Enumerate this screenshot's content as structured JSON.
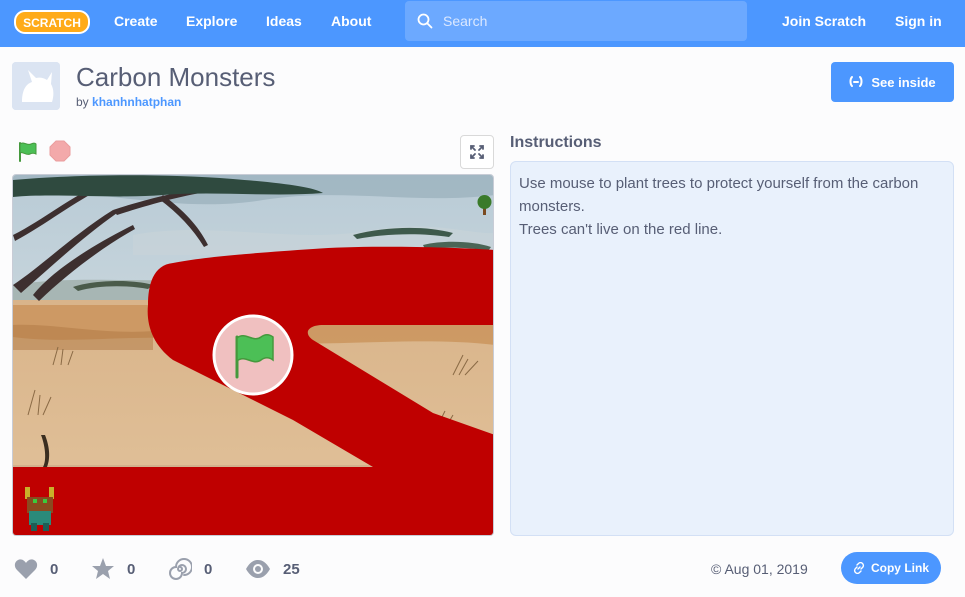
{
  "nav": {
    "logo_text": "SCRATCH",
    "create": "Create",
    "explore": "Explore",
    "ideas": "Ideas",
    "about": "About",
    "search_placeholder": "Search",
    "join": "Join Scratch",
    "signin": "Sign in"
  },
  "project": {
    "title": "Carbon Monsters",
    "by_prefix": "by",
    "author": "khanhnhatphan",
    "see_inside": "See inside"
  },
  "instructions": {
    "heading": "Instructions",
    "lines": [
      "Use mouse to plant trees to protect yourself from the carbon monsters.",
      "Trees can't live on the red line."
    ]
  },
  "stats": {
    "loves": "0",
    "favorites": "0",
    "remixes": "0",
    "views": "25"
  },
  "footer": {
    "date": "Aug 01, 2019",
    "copy_link": "Copy Link"
  },
  "colors": {
    "brand": "#4c97ff",
    "red_line": "#c00000",
    "green_flag": "#4cbf56"
  }
}
